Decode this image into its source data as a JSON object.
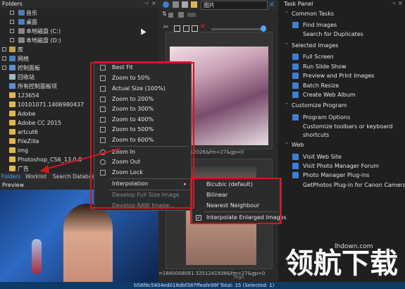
{
  "folders": {
    "title": "Folders",
    "items": [
      {
        "label": "音乐"
      },
      {
        "label": "桌面"
      },
      {
        "label": "本地磁盘 (C:)"
      },
      {
        "label": "本地磁盘 (D:)"
      },
      {
        "label": "库"
      },
      {
        "label": "网络"
      },
      {
        "label": "控制面板"
      },
      {
        "label": "回收站"
      },
      {
        "label": "所有控制面板项"
      },
      {
        "label": "123654"
      },
      {
        "label": "10101071.1406980437"
      },
      {
        "label": "Adobe"
      },
      {
        "label": "Adobe CC 2015"
      },
      {
        "label": "artcut6"
      },
      {
        "label": "FileZilla"
      },
      {
        "label": "img"
      },
      {
        "label": "Photoshop_CS6_13.0.0"
      },
      {
        "label": "广告"
      }
    ]
  },
  "bottom_tabs": [
    "Folders",
    "Worklist",
    "Search Database"
  ],
  "preview": {
    "title": "Preview"
  },
  "middle": {
    "folder_name": "图片",
    "caption1": "=1 1785312026&fm=27&gp=0",
    "caption2": "=1840008081 3251241938&fm=27&gp=0"
  },
  "context_menu": {
    "items": [
      {
        "label": "Best Fit",
        "disabled": false
      },
      {
        "label": "Zoom to 50%",
        "disabled": false
      },
      {
        "label": "Actual Size (100%)",
        "disabled": false
      },
      {
        "label": "Zoom to 200%",
        "disabled": false
      },
      {
        "label": "Zoom to 300%",
        "disabled": false
      },
      {
        "label": "Zoom to 400%",
        "disabled": false
      },
      {
        "label": "Zoom to 500%",
        "disabled": false
      },
      {
        "label": "Zoom to 600%",
        "disabled": false
      },
      {
        "label": "Zoom In",
        "disabled": false
      },
      {
        "label": "Zoom Out",
        "disabled": false
      },
      {
        "label": "Zoom Lock",
        "disabled": false
      },
      {
        "label": "Interpolation",
        "disabled": false
      },
      {
        "label": "Develop Full Size Image",
        "disabled": true
      },
      {
        "label": "Develop RAW Image...",
        "disabled": true
      }
    ]
  },
  "interpolation_submenu": {
    "items": [
      {
        "label": "Bicubic (default)"
      },
      {
        "label": "Bilinear"
      },
      {
        "label": "Nearest Neighbour"
      },
      {
        "label": "Interpolate Enlarged Images"
      }
    ]
  },
  "task_panel": {
    "title": "Task Panel",
    "rows": [
      {
        "type": "section",
        "label": "Common Tasks"
      },
      {
        "type": "item",
        "label": "Find Images"
      },
      {
        "type": "item",
        "label": "Search for Duplicates"
      },
      {
        "type": "section",
        "label": "Selected Images"
      },
      {
        "type": "item",
        "label": "Full Screen"
      },
      {
        "type": "item",
        "label": "Run Slide Show"
      },
      {
        "type": "item",
        "label": "Preview and Print Images"
      },
      {
        "type": "item",
        "label": "Batch Resize"
      },
      {
        "type": "item",
        "label": "Create Web Album"
      },
      {
        "type": "section",
        "label": "Customize Program"
      },
      {
        "type": "item",
        "label": "Program Options"
      },
      {
        "type": "item",
        "label": "Customize toolbars or keyboard"
      },
      {
        "type": "item",
        "label": "shortcuts"
      },
      {
        "type": "section",
        "label": "Web"
      },
      {
        "type": "item",
        "label": "Visit Web Site"
      },
      {
        "type": "item",
        "label": "Visit Photo Manager Forum"
      },
      {
        "type": "item",
        "label": "Photo Manager Plug-ins"
      },
      {
        "type": "item",
        "label": "GetPhotos Plug-in for Canon Cameras"
      }
    ]
  },
  "watermark": {
    "text": "领航下载",
    "site": "lhdown.com"
  },
  "status_bar": {
    "text": "b58f8c5404ed016dbf387ffeafe99f  Total: 15 (Selected: 1)",
    "tags": "Tags"
  },
  "colors": {
    "highlight": "#d8141b",
    "status": "#0e3a66",
    "accent": "#3d7fd6"
  }
}
